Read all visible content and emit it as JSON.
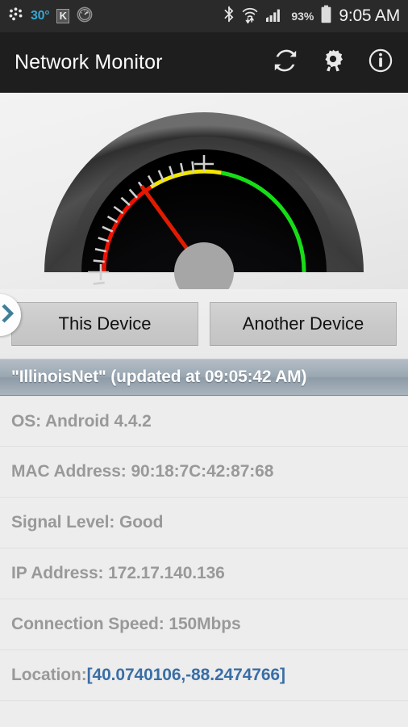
{
  "status_bar": {
    "temperature": "30°",
    "keyboard_indicator": "K",
    "battery_percent": "93%",
    "clock": "9:05 AM",
    "icons": {
      "dots_circle": "dots-circle-icon",
      "keyboard_badge": "keyboard-k-icon",
      "compass": "compass-gauge-icon",
      "bluetooth": "bluetooth-icon",
      "wifi": "wifi-transfer-icon",
      "cellular": "cellular-signal-icon",
      "battery": "battery-icon"
    },
    "background_color": "#2a2a2a",
    "accent_color": "#35a8d4"
  },
  "action_bar": {
    "title": "Network Monitor",
    "actions": [
      {
        "name": "refresh-button",
        "icon": "refresh-icon"
      },
      {
        "name": "settings-button",
        "icon": "gear-icon"
      },
      {
        "name": "info-button",
        "icon": "info-circle-icon"
      }
    ],
    "background_color": "#1e1e1e"
  },
  "gauge": {
    "name": "signal-speed-gauge",
    "needle_color": "#e01b00",
    "hub_color": "#a6a6a6",
    "face_color": "#060608",
    "bezel_color": "#3c3c3c",
    "zones": [
      {
        "label": "poor",
        "color": "#ee1100",
        "start_deg": 0,
        "end_deg": 62
      },
      {
        "label": "fair",
        "color": "#f3e600",
        "start_deg": 62,
        "end_deg": 100
      },
      {
        "label": "good",
        "color": "#17dd17",
        "start_deg": 100,
        "end_deg": 180
      }
    ],
    "needle_angle_deg": 144,
    "tick_count": 31
  },
  "device_tabs": {
    "buttons": [
      {
        "name": "this-device-button",
        "label": "This Device",
        "selected": true
      },
      {
        "name": "another-device-button",
        "label": "Another Device",
        "selected": false
      }
    ]
  },
  "drawer": {
    "handle_icon": "chevron-right-icon",
    "handle_color": "#3f7f9a"
  },
  "network_header": {
    "text": "\"IllinoisNet\" (updated at 09:05:42 AM)",
    "ssid": "IllinoisNet",
    "updated_at": "09:05:42 AM",
    "band_color": "#9aa7b2"
  },
  "details": {
    "rows": [
      {
        "name": "detail-row-os",
        "text": "OS: Android 4.4.2",
        "link": null
      },
      {
        "name": "detail-row-mac",
        "text": "MAC Address: 90:18:7C:42:87:68",
        "link": null
      },
      {
        "name": "detail-row-signal",
        "text": "Signal Level: Good",
        "link": null
      },
      {
        "name": "detail-row-ip",
        "text": "IP Address: 172.17.140.136",
        "link": null
      },
      {
        "name": "detail-row-speed",
        "text": "Connection Speed: 150Mbps",
        "link": null
      },
      {
        "name": "detail-row-location",
        "text": "Location: ",
        "link": "[40.0740106,-88.2474766]"
      }
    ],
    "text_color": "#999999",
    "link_color": "#3a6ea5"
  }
}
